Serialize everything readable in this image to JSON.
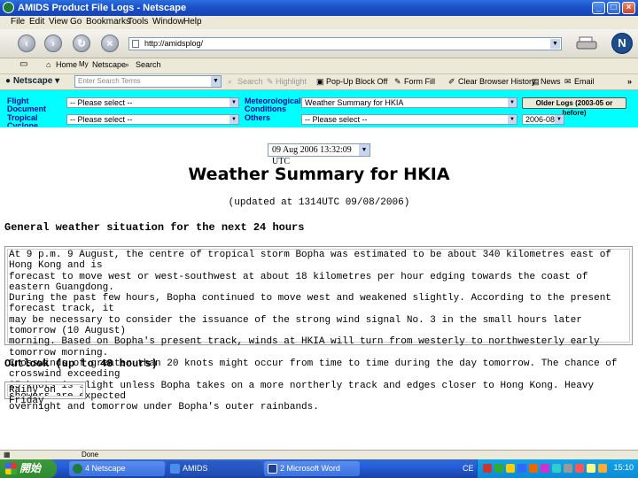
{
  "window": {
    "title": "AMIDS Product File Logs - Netscape"
  },
  "menu": [
    "File",
    "Edit",
    "View",
    "Go",
    "Bookmarks",
    "Tools",
    "Window",
    "Help"
  ],
  "address": {
    "url": "http://amidsplog/"
  },
  "personal_bar": {
    "home": "Home",
    "netscape": "Netscape",
    "search": "Search"
  },
  "toolbar": {
    "netscape": "Netscape",
    "search_placeholder": "Enter Search Terms",
    "search": "Search",
    "highlight": "Highlight",
    "popup": "Pop-Up Block Off",
    "formfill": "Form Fill",
    "clear_history": "Clear Browser History",
    "news": "News",
    "email": "Email"
  },
  "selectors": {
    "flight_label": "Flight Document",
    "flight_value": "-- Please select --",
    "met_label": "Meteorological Conditions",
    "met_value": "Weather Summary for HKIA",
    "older_button": "Older Logs (2003-05 or before)",
    "tc_label": "Tropical Cyclone Information",
    "tc_value": "-- Please select --",
    "others_label": "Others",
    "others_value": "-- Please select --",
    "month_value": "2006-08"
  },
  "content": {
    "datetime": "09 Aug 2006 13:32:09 UTC",
    "heading": "Weather Summary for HKIA",
    "updated": "(updated at 1314UTC 09/08/2006)",
    "general_heading": "General weather situation for the next 24 hours",
    "general_lines": [
      "At 9 p.m. 9 August, the centre of tropical storm Bopha was estimated to be about 340 kilometres east of Hong Kong and is",
      "forecast to move west or west-southwest at about 18 kilometres per hour edging towards the coast of eastern Guangdong.",
      "During the past few hours, Bopha continued to move west and weakened slightly. According to the present forecast track, it",
      "may be necessary to consider the issuance of the strong wind signal No. 3 in the small hours later tomorrow (10 August)",
      "morning. Based on Bopha's present track, winds at HKIA will turn from westerly to northwesterly early tomorrow morning.",
      "Crosswinds of greater than 20 knots might occur from time to time during the day tomorrow. The chance of crosswind exceeding",
      "25 knots is slight unless Bopha takes on a more northerly track and edges closer to Hong Kong. Heavy showers are expected",
      "overnight and tomorrow under Bopha's outer rainbands."
    ],
    "outlook_heading": "Outlook (up to 48 hours)",
    "outlook": "Rainy on Friday"
  },
  "status": {
    "text": "Done"
  },
  "taskbar": {
    "start": "開始",
    "tasks": [
      "4 Netscape",
      "AMIDS",
      "2 Microsoft Word"
    ],
    "lang": "CE",
    "clock": "15:10"
  },
  "colors": {
    "selector_band": "#00ffff",
    "label_text": "#0000a0",
    "title_bar": "#1a4fc6"
  }
}
